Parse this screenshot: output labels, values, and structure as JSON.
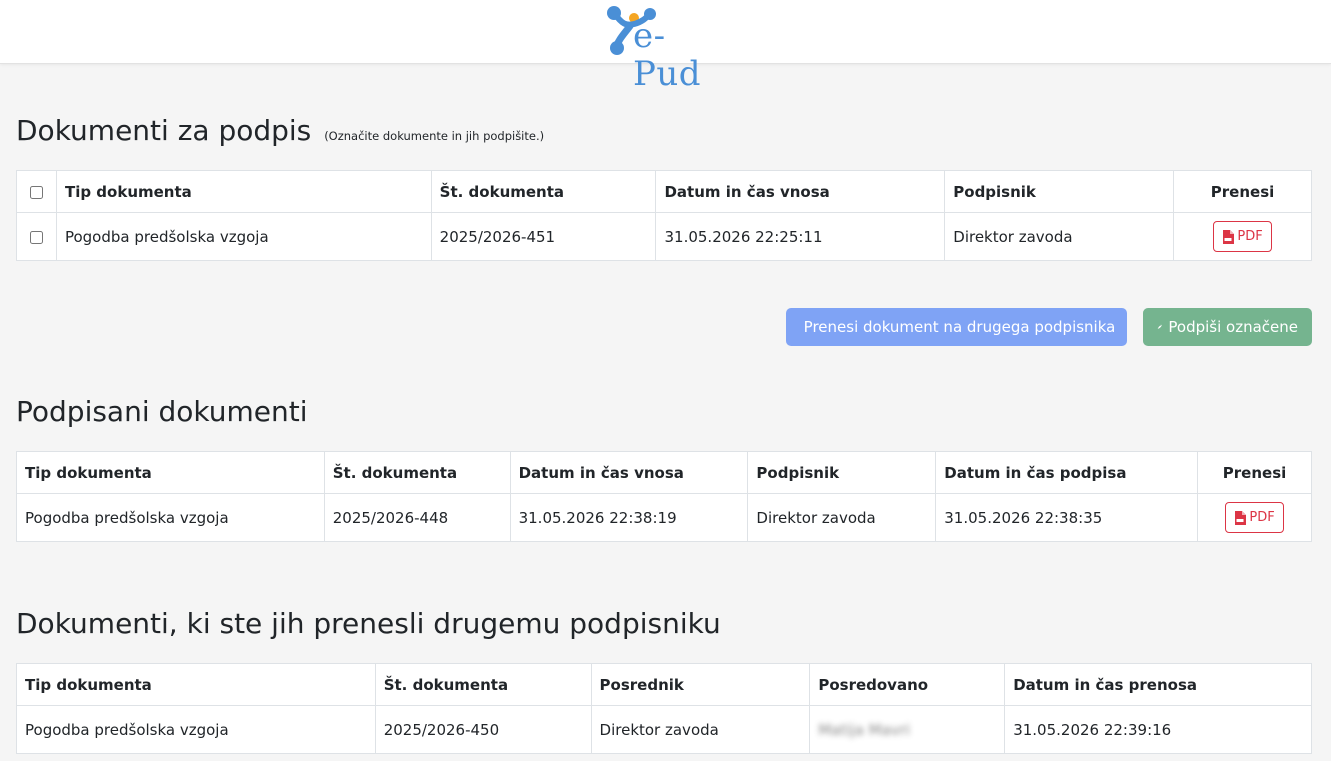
{
  "app": {
    "logo_text": "e-Pud"
  },
  "sign_section": {
    "title": "Dokumenti za podpis",
    "hint": "(Označite dokumente in jih podpišite.)",
    "columns": [
      "Tip dokumenta",
      "Št. dokumenta",
      "Datum in čas vnosa",
      "Podpisnik",
      "Prenesi"
    ],
    "rows": [
      {
        "type": "Pogodba predšolska vzgoja",
        "number": "2025/2026-451",
        "entered": "31.05.2026 22:25:11",
        "signer": "Direktor zavoda",
        "download": "PDF"
      }
    ],
    "transfer_button": "Prenesi dokument na drugega podpisnika",
    "sign_button": "Podpiši označene"
  },
  "signed_section": {
    "title": "Podpisani dokumenti",
    "columns": [
      "Tip dokumenta",
      "Št. dokumenta",
      "Datum in čas vnosa",
      "Podpisnik",
      "Datum in čas podpisa",
      "Prenesi"
    ],
    "rows": [
      {
        "type": "Pogodba predšolska vzgoja",
        "number": "2025/2026-448",
        "entered": "31.05.2026 22:38:19",
        "signer": "Direktor zavoda",
        "signed": "31.05.2026 22:38:35",
        "download": "PDF"
      }
    ]
  },
  "transferred_section": {
    "title": "Dokumenti, ki ste jih prenesli drugemu podpisniku",
    "columns": [
      "Tip dokumenta",
      "Št. dokumenta",
      "Posrednik",
      "Posredovano",
      "Datum in čas prenosa"
    ],
    "rows": [
      {
        "type": "Pogodba predšolska vzgoja",
        "number": "2025/2026-450",
        "intermediary": "Direktor zavoda",
        "forwarded_to": "Matija Mavri",
        "transferred": "31.05.2026 22:39:16"
      }
    ]
  },
  "colors": {
    "pdf": "#dc3545",
    "transfer_button": "#7fa3f5",
    "sign_button": "#75b48f",
    "logo_blue": "#4a8fd6",
    "logo_orange": "#f5a623"
  },
  "icons": {
    "pdf": "file-pdf-icon",
    "transfer": "paper-plane-icon",
    "sign": "signature-pen-icon"
  }
}
